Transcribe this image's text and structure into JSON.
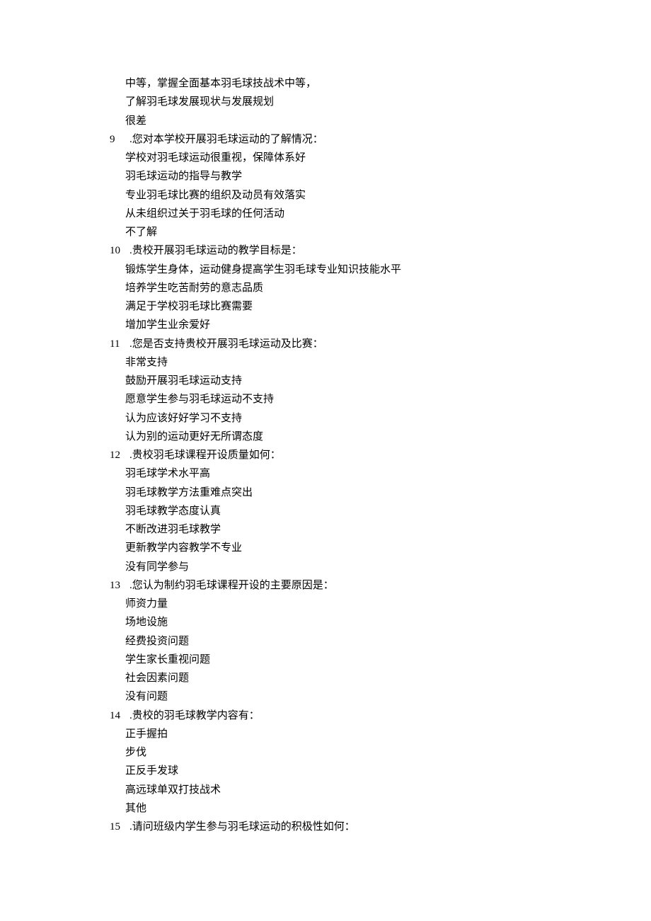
{
  "leadingOptions": [
    "中等，掌握全面基本羽毛球技战术中等，",
    "了解羽毛球发展现状与发展规划",
    "很差"
  ],
  "questions": [
    {
      "number": "9",
      "text": ".您对本学校开展羽毛球运动的了解情况：",
      "options": [
        "学校对羽毛球运动很重视，保障体系好",
        "羽毛球运动的指导与教学",
        "专业羽毛球比赛的组织及动员有效落实",
        "从未组织过关于羽毛球的任何活动",
        "不了解"
      ]
    },
    {
      "number": "10",
      "text": ".贵校开展羽毛球运动的教学目标是：",
      "options": [
        "锻炼学生身体，运动健身提高学生羽毛球专业知识技能水平",
        "培养学生吃苦耐劳的意志品质",
        "满足于学校羽毛球比赛需要",
        "增加学生业余爱好"
      ]
    },
    {
      "number": "11",
      "text": ".您是否支持贵校开展羽毛球运动及比赛：",
      "options": [
        "非常支持",
        "鼓励开展羽毛球运动支持",
        "愿意学生参与羽毛球运动不支持",
        "认为应该好好学习不支持",
        "认为别的运动更好无所谓态度"
      ]
    },
    {
      "number": "12",
      "text": ".贵校羽毛球课程开设质量如何：",
      "options": [
        "羽毛球学术水平高",
        "羽毛球教学方法重难点突出",
        "羽毛球教学态度认真",
        "不断改进羽毛球教学",
        "更新教学内容教学不专业",
        "没有同学参与"
      ]
    },
    {
      "number": "13",
      "text": ".您认为制约羽毛球课程开设的主要原因是：",
      "options": [
        "师资力量",
        "场地设施",
        "经费投资问题",
        "学生家长重视问题",
        "社会因素问题",
        "没有问题"
      ]
    },
    {
      "number": "14",
      "text": ".贵校的羽毛球教学内容有：",
      "options": [
        "正手握拍",
        "步伐",
        "正反手发球",
        "高远球单双打技战术",
        "其他"
      ]
    },
    {
      "number": "15",
      "text": ".请问班级内学生参与羽毛球运动的积极性如何：",
      "options": []
    }
  ]
}
